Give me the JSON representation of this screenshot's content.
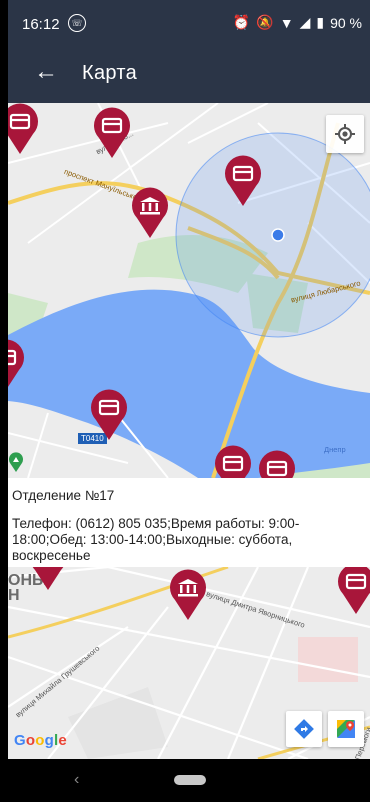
{
  "status_bar": {
    "time": "16:12",
    "battery": "90 %",
    "icons": [
      "whatsapp-icon",
      "alarm-icon",
      "mute-icon",
      "wifi-icon",
      "signal-icon",
      "battery-icon"
    ]
  },
  "app_bar": {
    "title": "Карта",
    "back_icon": "arrow-back-icon"
  },
  "map_top": {
    "street_labels": [
      "вулиця Ко...",
      "проспект Мануїльського",
      "вулиця Любарського",
      "Днепр"
    ],
    "road_shield": "T0410",
    "marker_types": [
      "card",
      "card",
      "card",
      "bank",
      "card",
      "card",
      "card",
      "card"
    ]
  },
  "info_panel": {
    "branch_name": "Отделение №17",
    "details": "Телефон: (0612) 805 035;Время работы: 9:00-18:00;Обед: 13:00-14:00;Выходные: суббота, воскресенье"
  },
  "map_bottom": {
    "area_label": "ОНЫ\nН",
    "street_labels": [
      "вулиця Михайла Грушевського",
      "вулиця Дмитра Яворницького",
      "Перемоги"
    ],
    "marker_types": [
      "card",
      "bank",
      "card"
    ],
    "attribution": "Google"
  },
  "colors": {
    "header": "#2b3547",
    "marker": "#a8163a",
    "water": "#7aaaf7",
    "park": "#cfe7c8",
    "highway": "#f4cf5e"
  }
}
